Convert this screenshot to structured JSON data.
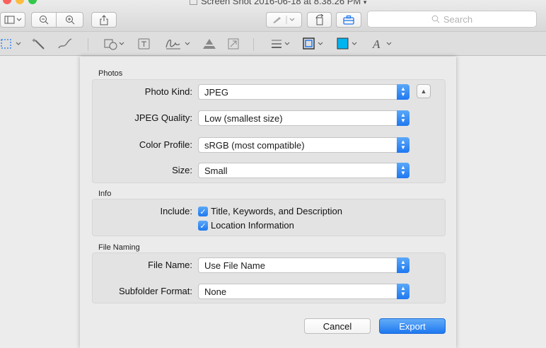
{
  "window": {
    "title": "Screen Shot 2016-06-18 at 8.38.26 PM"
  },
  "toolbar": {
    "search_placeholder": "Search"
  },
  "colors": {
    "accent": "#1f78f0",
    "fill_color": "#00b4f0",
    "close": "#fc605b",
    "minimize": "#fdbc40",
    "zoom": "#34c84a"
  },
  "sections": {
    "photos": {
      "title": "Photos",
      "photo_kind": {
        "label": "Photo Kind:",
        "value": "JPEG"
      },
      "jpeg_quality": {
        "label": "JPEG Quality:",
        "value": "Low (smallest size)"
      },
      "color_profile": {
        "label": "Color Profile:",
        "value": "sRGB (most compatible)"
      },
      "size": {
        "label": "Size:",
        "value": "Small"
      }
    },
    "info": {
      "title": "Info",
      "include_label": "Include:",
      "options": [
        "Title, Keywords, and Description",
        "Location Information"
      ]
    },
    "file_naming": {
      "title": "File Naming",
      "file_name": {
        "label": "File Name:",
        "value": "Use File Name"
      },
      "subfolder_format": {
        "label": "Subfolder Format:",
        "value": "None"
      }
    }
  },
  "buttons": {
    "cancel": "Cancel",
    "export": "Export"
  },
  "icons": [
    "sidebar-icon",
    "zoom-out-icon",
    "zoom-in-icon",
    "share-icon",
    "markup-icon",
    "rotate-icon",
    "toolbox-icon",
    "selection-icon",
    "instant-alpha-icon",
    "sketch-icon",
    "shapes-icon",
    "text-icon",
    "sign-icon",
    "adjust-color-icon",
    "adjust-size-icon",
    "line-style-icon",
    "border-color-icon",
    "fill-color-icon",
    "text-style-icon"
  ]
}
